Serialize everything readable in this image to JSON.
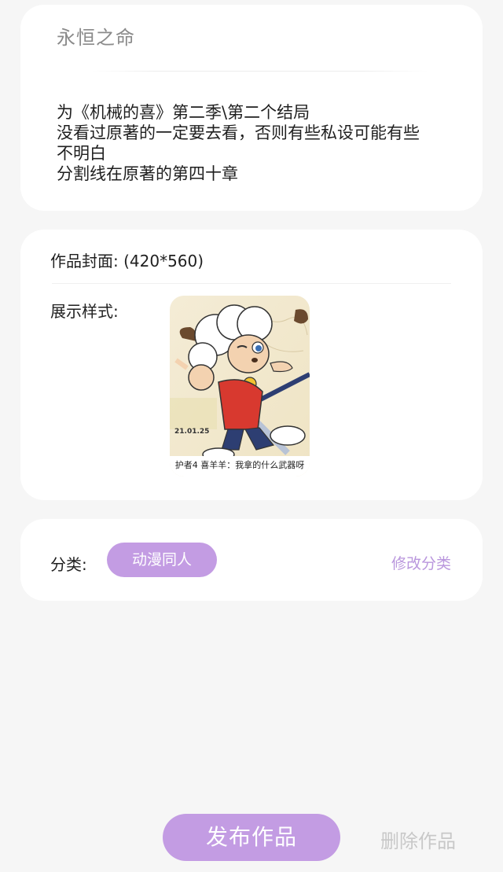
{
  "work": {
    "title": "永恒之命",
    "description_lines": [
      "为《机械的喜》第二季\\第二个结局",
      "没看过原著的一定要去看，否则有些私设可能有些",
      "不明白",
      "分割线在原著的第四十章"
    ]
  },
  "cover": {
    "label": "作品封面: (420*560)",
    "style_label": "展示样式:",
    "image_caption": "护者4 喜羊羊：我拿的什么武器呀",
    "image_date": "21.01.25"
  },
  "category": {
    "label": "分类:",
    "value": "动漫同人",
    "edit_label": "修改分类"
  },
  "actions": {
    "publish_label": "发布作品",
    "delete_label": "删除作品"
  },
  "colors": {
    "accent": "#c39ce3",
    "accent_text": "#b996dd",
    "disabled_text": "#c8c8c8",
    "background": "#f6f6f6"
  }
}
